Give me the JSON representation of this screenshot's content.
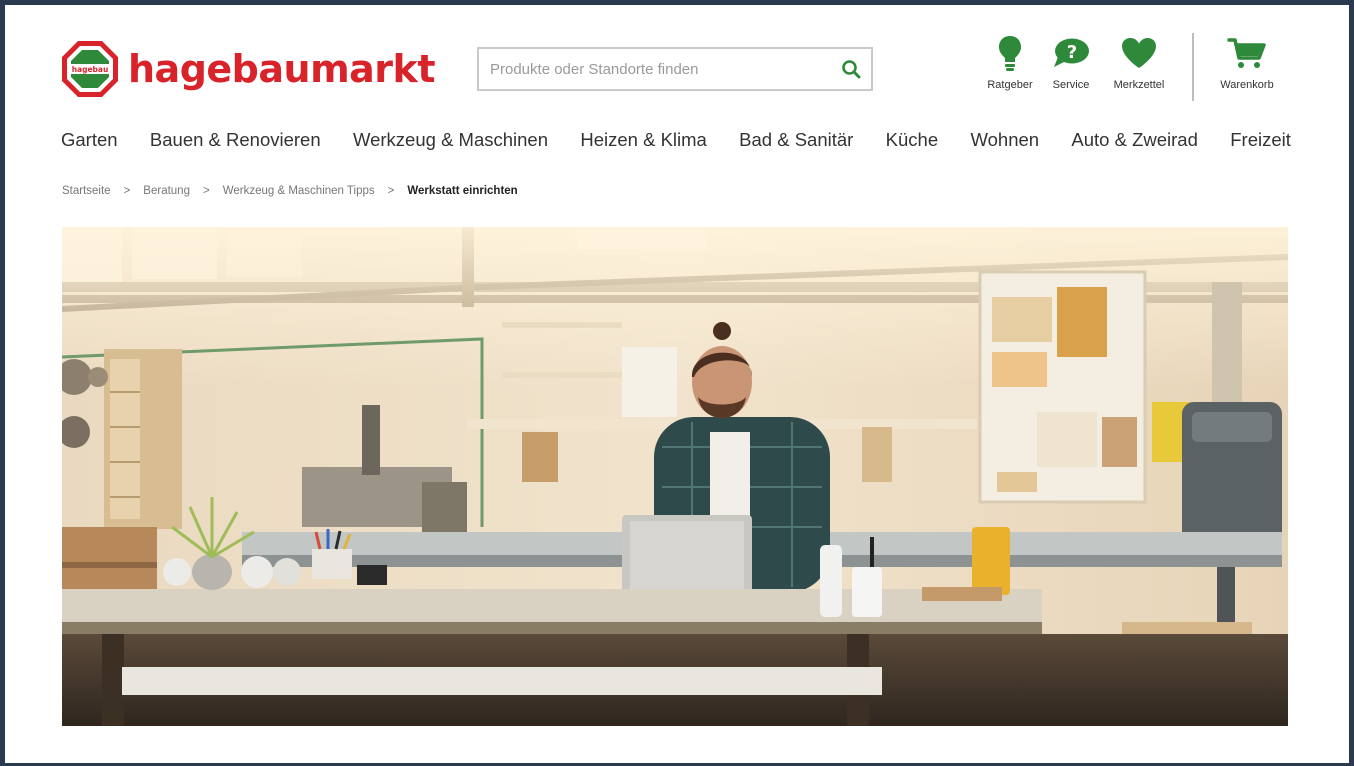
{
  "brand": {
    "badge_text": "hagebau",
    "name": "hagebaumarkt",
    "color": "#d8232a",
    "accent": "#2e8a3a"
  },
  "search": {
    "placeholder": "Produkte oder Standorte finden",
    "icon": "search-icon"
  },
  "header_icons": [
    {
      "label": "Ratgeber",
      "icon": "lightbulb-icon"
    },
    {
      "label": "Service",
      "icon": "question-bubble-icon"
    },
    {
      "label": "Merkzettel",
      "icon": "heart-icon"
    },
    {
      "label": "Warenkorb",
      "icon": "cart-icon"
    }
  ],
  "nav": {
    "items": [
      "Garten",
      "Bauen & Renovieren",
      "Werkzeug & Maschinen",
      "Heizen & Klima",
      "Bad & Sanitär",
      "Küche",
      "Wohnen",
      "Auto & Zweirad",
      "Freizeit"
    ]
  },
  "breadcrumb": {
    "items": [
      "Startseite",
      "Beratung",
      "Werkzeug & Maschinen Tipps"
    ],
    "current": "Werkstatt einrichten",
    "separator": ">"
  },
  "hero": {
    "scene": "workshop-photo"
  }
}
